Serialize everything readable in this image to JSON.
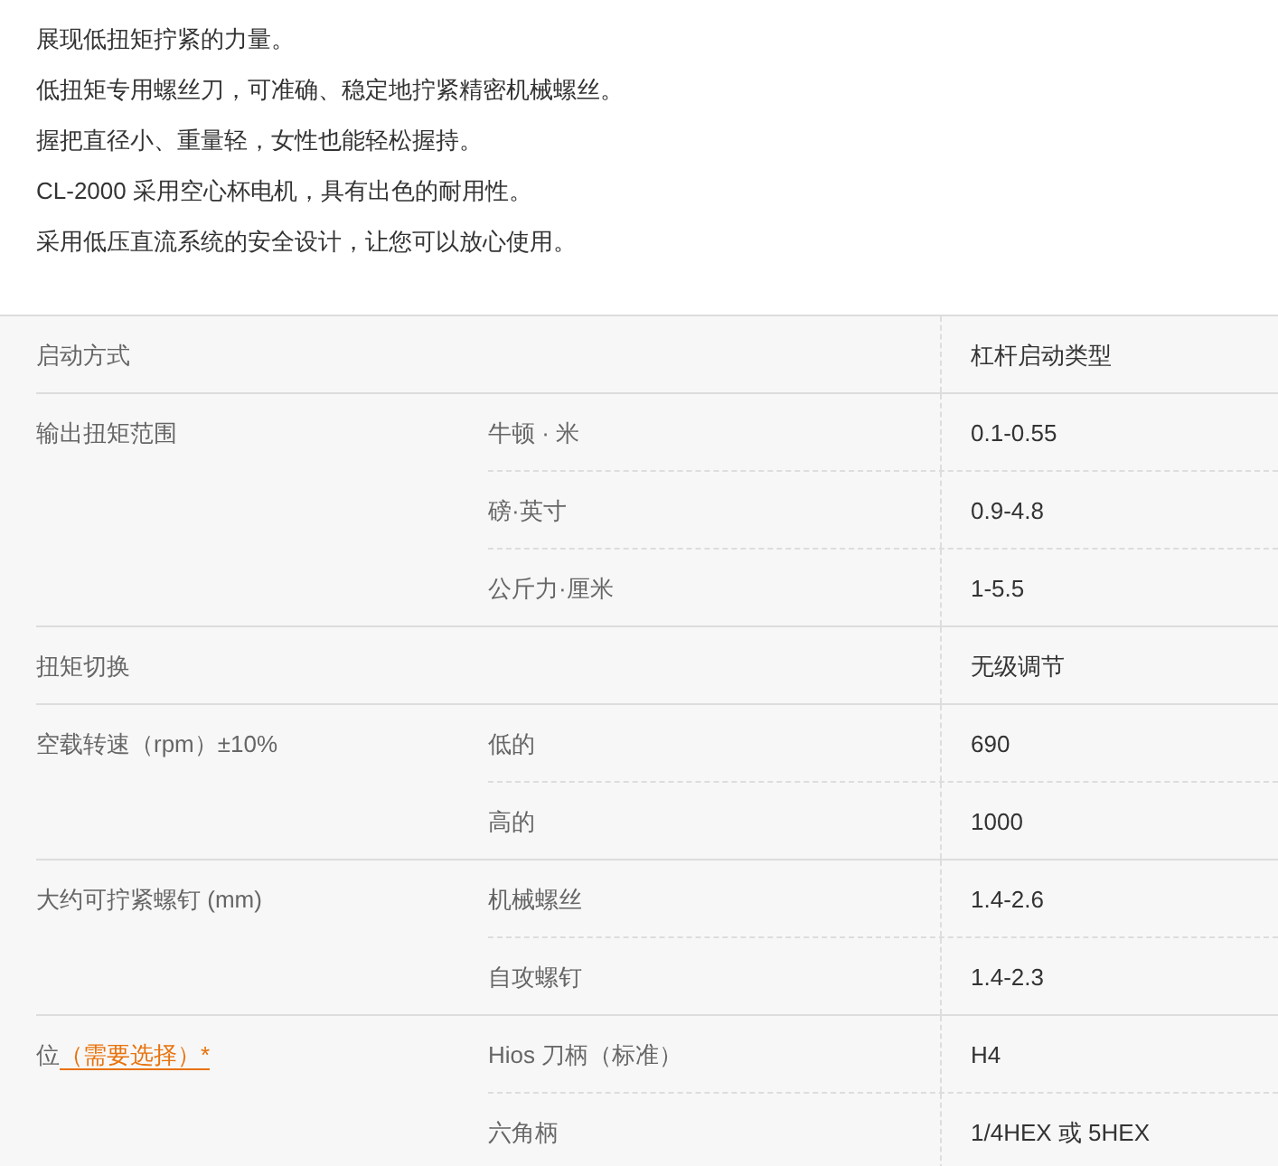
{
  "intro": [
    "展现低扭矩拧紧的力量。",
    "低扭矩专用螺丝刀，可准确、稳定地拧紧精密机械螺丝。",
    "握把直径小、重量轻，女性也能轻松握持。",
    "CL-2000 采用空心杯电机，具有出色的耐用性。",
    "采用低压直流系统的安全设计，让您可以放心使用。"
  ],
  "specs": [
    {
      "label": "启动方式",
      "rows": [
        {
          "value": "杠杆启动类型"
        }
      ]
    },
    {
      "label": "输出扭矩范围",
      "rows": [
        {
          "sub": "牛顿 · 米",
          "value": "0.1-0.55"
        },
        {
          "sub": "磅·英寸",
          "value": "0.9-4.8"
        },
        {
          "sub": "公斤力·厘米",
          "value": "1-5.5"
        }
      ]
    },
    {
      "label": "扭矩切换",
      "rows": [
        {
          "value": "无级调节"
        }
      ]
    },
    {
      "label": "空载转速（rpm）±10%",
      "rows": [
        {
          "sub": "低的",
          "value": "690"
        },
        {
          "sub": "高的",
          "value": "1000"
        }
      ]
    },
    {
      "label": "大约可拧紧螺钉 (mm)",
      "rows": [
        {
          "sub": "机械螺丝",
          "value": "1.4-2.6"
        },
        {
          "sub": "自攻螺钉",
          "value": "1.4-2.3"
        }
      ]
    },
    {
      "label": "位",
      "link": "（需要选择）*",
      "rows": [
        {
          "sub": "Hios 刀柄（标准）",
          "value": "H4"
        },
        {
          "sub": "六角柄",
          "value": "1/4HEX 或 5HEX"
        }
      ]
    }
  ]
}
